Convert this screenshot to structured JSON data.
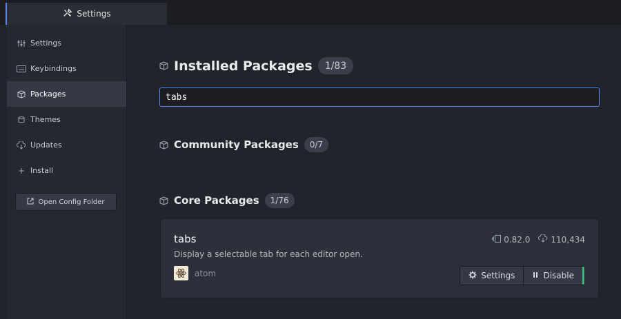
{
  "tab": {
    "label": "Settings",
    "icon": "tools-icon"
  },
  "sidebar": {
    "items": [
      {
        "label": "Settings",
        "icon": "sliders-icon"
      },
      {
        "label": "Keybindings",
        "icon": "keyboard-icon"
      },
      {
        "label": "Packages",
        "icon": "package-icon"
      },
      {
        "label": "Themes",
        "icon": "paintcan-icon"
      },
      {
        "label": "Updates",
        "icon": "cloud-download-icon"
      },
      {
        "label": "Install",
        "icon": "plus-icon"
      }
    ],
    "active": "Packages",
    "open_config_label": "Open Config Folder"
  },
  "main": {
    "installed": {
      "title": "Installed Packages",
      "count": "1/83"
    },
    "search": {
      "value": "tabs"
    },
    "community": {
      "title": "Community Packages",
      "count": "0/7"
    },
    "core": {
      "title": "Core Packages",
      "count": "1/76"
    },
    "package": {
      "name": "tabs",
      "description": "Display a selectable tab for each editor open.",
      "version": "0.82.0",
      "downloads": "110,434",
      "author": "atom",
      "settings_label": "Settings",
      "disable_label": "Disable"
    }
  },
  "colors": {
    "accent": "#568af2",
    "enabled": "#3fb67f",
    "background": "#21242b"
  }
}
